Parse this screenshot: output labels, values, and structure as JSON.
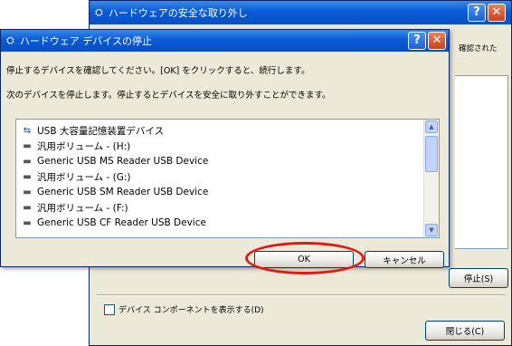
{
  "back_window": {
    "title": "ハードウェアの安全な取り外し",
    "right_note": "確認された",
    "stop_button": "停止(S)",
    "show_components_label": "デバイス コンポーネントを表示する(D)",
    "close_button": "閉じる(C)"
  },
  "dialog": {
    "title": "ハードウェア デバイスの停止",
    "instruction_1": "停止するデバイスを確認してください。[OK] をクリックすると、続行します。",
    "instruction_2": "次のデバイスを停止します。停止するとデバイスを安全に取り外すことができます。",
    "devices": [
      {
        "label": "USB 大容量記憶装置デバイス",
        "icon": "usb-device-icon"
      },
      {
        "label": "汎用ボリューム - (H:)",
        "icon": "drive-icon"
      },
      {
        "label": "Generic USB MS Reader USB Device",
        "icon": "drive-icon"
      },
      {
        "label": "汎用ボリューム - (G:)",
        "icon": "drive-icon"
      },
      {
        "label": "Generic USB SM Reader USB Device",
        "icon": "drive-icon"
      },
      {
        "label": "汎用ボリューム - (F:)",
        "icon": "drive-icon"
      },
      {
        "label": "Generic USB CF Reader USB Device",
        "icon": "drive-icon"
      }
    ],
    "ok_button": "OK",
    "cancel_button": "キャンセル"
  },
  "title_buttons": {
    "help": "?",
    "close": "✕"
  },
  "colors": {
    "titlebar": "#0a5ad6",
    "highlight": "#e01818",
    "dialog_bg": "#ece9d8"
  }
}
